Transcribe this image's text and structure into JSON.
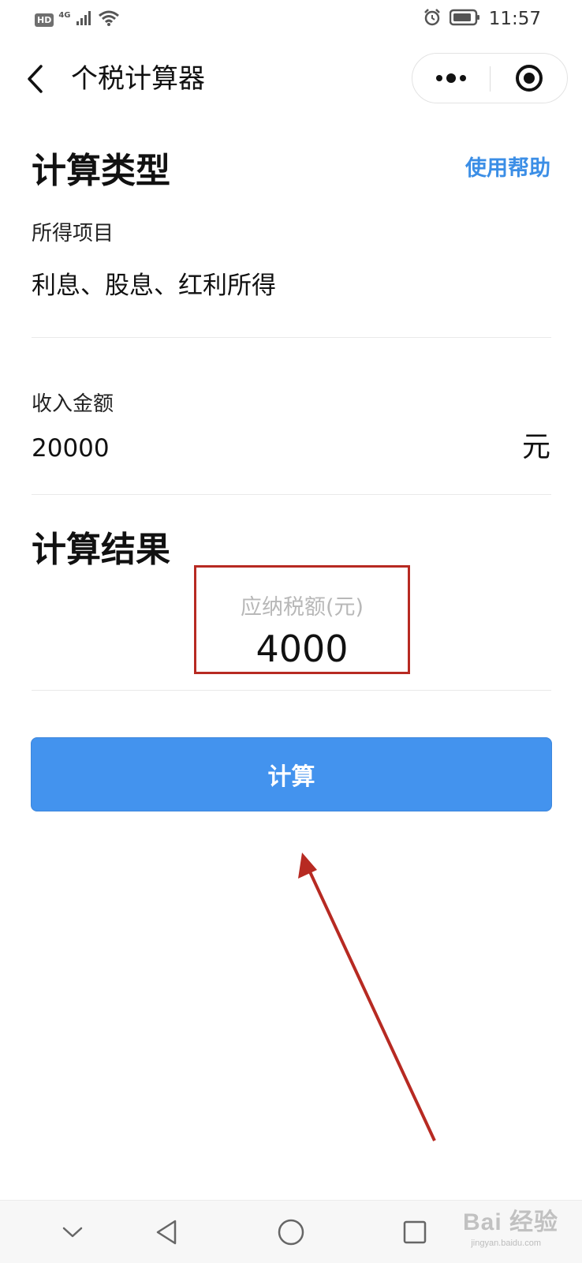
{
  "status_bar": {
    "hd": "HD",
    "network": "4G",
    "time": "11:57",
    "icons": [
      "signal-icon",
      "wifi-icon",
      "alarm-icon",
      "battery-icon"
    ]
  },
  "nav": {
    "title": "个税计算器",
    "icons": [
      "back-chevron-icon",
      "more-dots-icon",
      "close-miniprogram-icon"
    ]
  },
  "calc_type": {
    "heading": "计算类型",
    "help_label": "使用帮助",
    "item_label": "所得项目",
    "item_value": "利息、股息、红利所得"
  },
  "income": {
    "label": "收入金额",
    "value": "20000",
    "unit": "元"
  },
  "result": {
    "heading": "计算结果",
    "label": "应纳税额(元)",
    "value": "4000"
  },
  "button": {
    "label": "计算"
  },
  "system_nav": {
    "icons": [
      "chevron-down-icon",
      "back-triangle-icon",
      "home-circle-icon",
      "recents-square-icon"
    ]
  },
  "watermark": {
    "text": "Bai 经验",
    "sub": "jingyan.baidu.com"
  },
  "colors": {
    "accent_blue": "#4393ee",
    "help_link": "#3b8ee6",
    "annotation_red": "#b72a22"
  }
}
